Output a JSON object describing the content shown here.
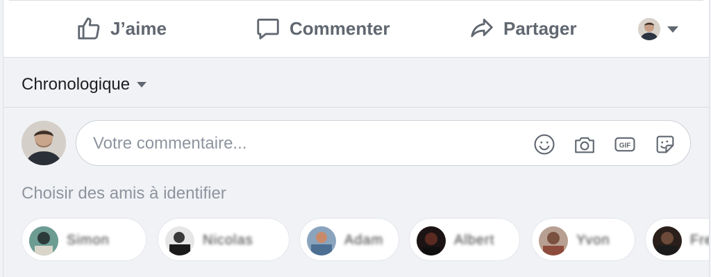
{
  "actions": {
    "like_label": "J’aime",
    "comment_label": "Commenter",
    "share_label": "Partager"
  },
  "comments": {
    "order_label": "Chronologique",
    "input_placeholder": "Votre commentaire...",
    "tools": [
      "emoji-icon",
      "camera-icon",
      "gif-icon",
      "sticker-icon"
    ],
    "tag_hint": "Choisir des amis à identifier"
  },
  "friend_suggestions": [
    {
      "name": "Simon"
    },
    {
      "name": "Nicolas"
    },
    {
      "name": "Adam"
    },
    {
      "name": "Albert"
    },
    {
      "name": "Yvon"
    },
    {
      "name": "Fred"
    }
  ],
  "colors": {
    "text_secondary": "#606770",
    "placeholder": "#8d949e",
    "background": "#f1f2f5",
    "surface": "#ffffff"
  }
}
